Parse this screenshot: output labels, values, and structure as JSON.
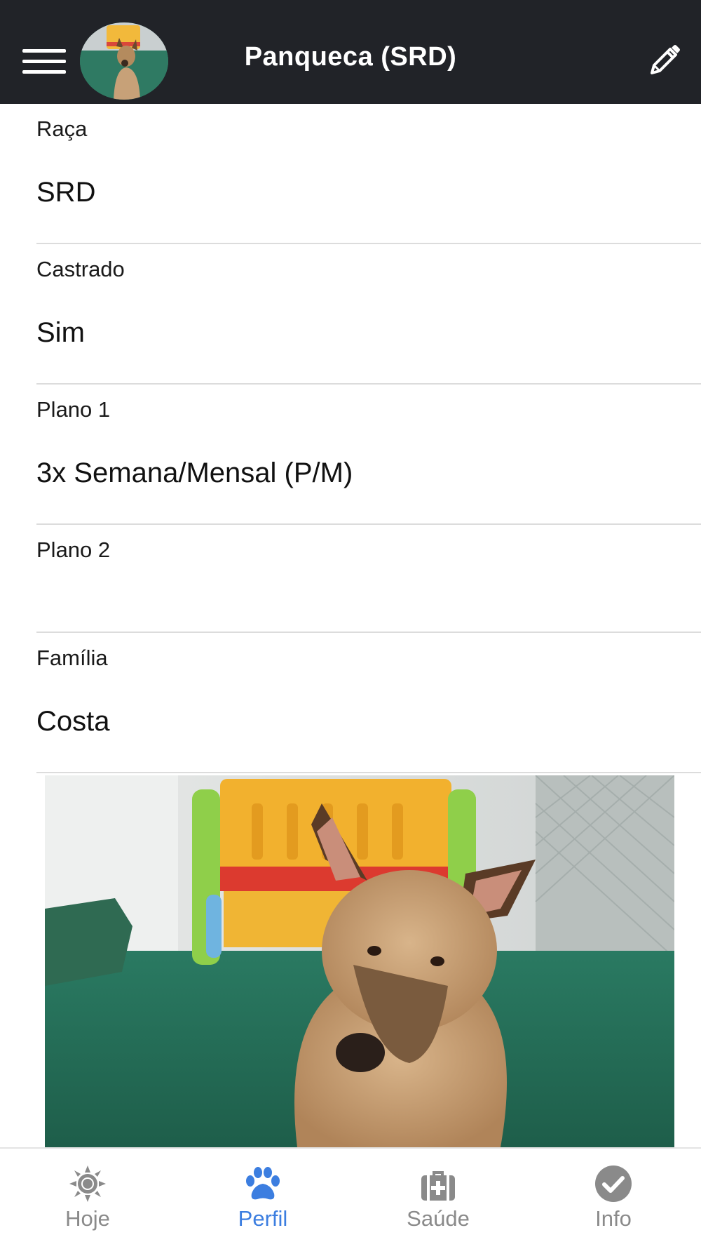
{
  "header": {
    "title": "Panqueca (SRD)"
  },
  "fields": [
    {
      "label": "Raça",
      "value": "SRD"
    },
    {
      "label": "Castrado",
      "value": "Sim"
    },
    {
      "label": "Plano 1",
      "value": "3x Semana/Mensal (P/M)"
    },
    {
      "label": "Plano 2",
      "value": ""
    },
    {
      "label": "Família",
      "value": "Costa"
    }
  ],
  "tabs": [
    {
      "label": "Hoje",
      "icon": "sun-icon",
      "active": false
    },
    {
      "label": "Perfil",
      "icon": "paw-icon",
      "active": true
    },
    {
      "label": "Saúde",
      "icon": "medical-kit-icon",
      "active": false
    },
    {
      "label": "Info",
      "icon": "check-circle-icon",
      "active": false
    }
  ],
  "colors": {
    "header_bg": "#212328",
    "tab_active": "#3c7ee0",
    "tab_inactive": "#8a8a8a"
  }
}
